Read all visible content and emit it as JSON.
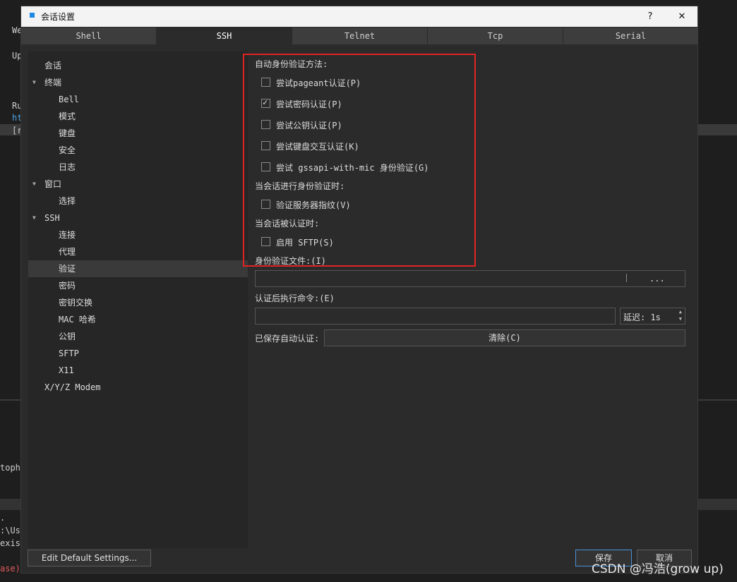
{
  "background_terminal": {
    "lines": [
      "We",
      "Up",
      "Ru",
      "ht",
      "[r",
      "toph",
      ".",
      ":\\Us",
      "exis",
      "ase)"
    ]
  },
  "dialog": {
    "title": "会话设置",
    "help_label": "?",
    "close_label": "✕"
  },
  "tabs": [
    "Shell",
    "SSH",
    "Telnet",
    "Tcp",
    "Serial"
  ],
  "tree": [
    {
      "label": "会话",
      "level": 0,
      "expand": ""
    },
    {
      "label": "终端",
      "level": 0,
      "expand": "▼"
    },
    {
      "label": "Bell",
      "level": 1,
      "expand": ""
    },
    {
      "label": "模式",
      "level": 1,
      "expand": ""
    },
    {
      "label": "键盘",
      "level": 1,
      "expand": ""
    },
    {
      "label": "安全",
      "level": 1,
      "expand": ""
    },
    {
      "label": "日志",
      "level": 1,
      "expand": ""
    },
    {
      "label": "窗口",
      "level": 0,
      "expand": "▼"
    },
    {
      "label": "选择",
      "level": 1,
      "expand": ""
    },
    {
      "label": "SSH",
      "level": 0,
      "expand": "▼"
    },
    {
      "label": "连接",
      "level": 1,
      "expand": ""
    },
    {
      "label": "代理",
      "level": 1,
      "expand": ""
    },
    {
      "label": "验证",
      "level": 1,
      "expand": "",
      "selected": true
    },
    {
      "label": "密码",
      "level": 1,
      "expand": ""
    },
    {
      "label": "密钥交换",
      "level": 1,
      "expand": ""
    },
    {
      "label": "MAC 哈希",
      "level": 1,
      "expand": ""
    },
    {
      "label": "公钥",
      "level": 1,
      "expand": ""
    },
    {
      "label": "SFTP",
      "level": 1,
      "expand": ""
    },
    {
      "label": "X11",
      "level": 1,
      "expand": ""
    },
    {
      "label": "X/Y/Z Modem",
      "level": 0,
      "expand": ""
    }
  ],
  "auth": {
    "methods_header": "自动身份验证方法:",
    "options": [
      {
        "label": "尝试pageant认证(P)",
        "checked": false
      },
      {
        "label": "尝试密码认证(P)",
        "checked": true
      },
      {
        "label": "尝试公钥认证(P)",
        "checked": false
      },
      {
        "label": "尝试键盘交互认证(K)",
        "checked": false
      },
      {
        "label": "尝试 gssapi-with-mic 身份验证(G)",
        "checked": false
      }
    ],
    "during_header": "当会话进行身份验证时:",
    "verify_fingerprint": {
      "label": "验证服务器指纹(V)",
      "checked": false
    },
    "after_header": "当会话被认证时:",
    "enable_sftp": {
      "label": "启用 SFTP(S)",
      "checked": false
    },
    "identity_file_label": "身份验证文件:(I)",
    "identity_file_value": "",
    "browse_label": "...",
    "post_cmd_label": "认证后执行命令:(E)",
    "post_cmd_value": "",
    "delay_label": "延迟: 1s",
    "saved_auth_label": "已保存自动认证:",
    "clear_label": "清除(C)"
  },
  "footer": {
    "edit_default": "Edit Default Settings...",
    "save": "保存",
    "cancel": "取消"
  },
  "watermark": "CSDN @冯浩(grow up)"
}
